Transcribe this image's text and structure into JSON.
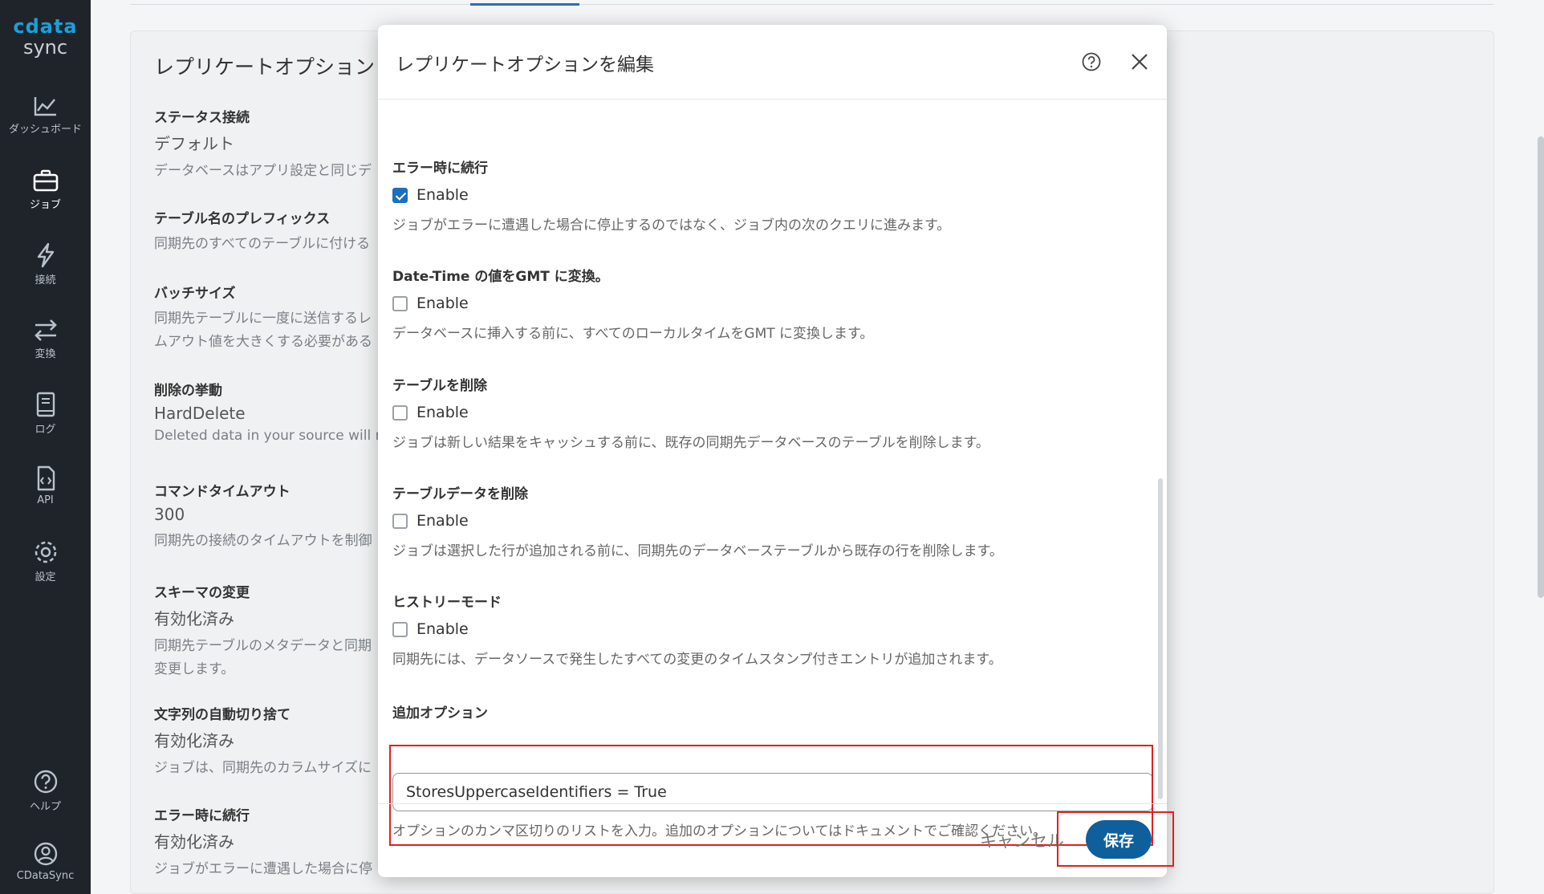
{
  "sidebar": {
    "logo_top": "cdata",
    "logo_bottom": "sync",
    "items": [
      {
        "label": "ダッシュボード",
        "icon": "chart-line-icon"
      },
      {
        "label": "ジョブ",
        "icon": "briefcase-icon"
      },
      {
        "label": "接続",
        "icon": "lightning-icon"
      },
      {
        "label": "変換",
        "icon": "arrows-swap-icon"
      },
      {
        "label": "ログ",
        "icon": "log-book-icon"
      },
      {
        "label": "API",
        "icon": "api-file-icon"
      },
      {
        "label": "設定",
        "icon": "gear-icon"
      },
      {
        "label": "ヘルプ",
        "icon": "help-circle-icon"
      },
      {
        "label": "CDataSync",
        "icon": "user-icon"
      }
    ]
  },
  "background": {
    "title": "レプリケートオプション",
    "items": [
      {
        "label": "ステータス接続",
        "value": "デフォルト",
        "desc": "データベースはアプリ設定と同じデ"
      },
      {
        "label": "テーブル名のプレフィックス",
        "desc": "同期先のすべてのテーブルに付ける"
      },
      {
        "label": "バッチサイズ",
        "desc": "同期先テーブルに一度に送信するレ",
        "desc2": "ムアウト値を大きくする必要がある"
      },
      {
        "label": "削除の挙動",
        "value": "HardDelete",
        "desc": "Deleted data in your source will remo"
      },
      {
        "label": "コマンドタイムアウト",
        "value": "300",
        "desc": "同期先の接続のタイムアウトを制御"
      },
      {
        "label": "スキーマの変更",
        "value": "有効化済み",
        "desc": "同期先テーブルのメタデータと同期",
        "desc2": "変更します。"
      },
      {
        "label": "文字列の自動切り捨て",
        "value": "有効化済み",
        "desc": "ジョブは、同期先のカラムサイズに"
      },
      {
        "label": "エラー時に続行",
        "value": "有効化済み",
        "desc": "ジョブがエラーに遭遇した場合に停"
      }
    ]
  },
  "modal": {
    "title": "レプリケートオプションを編集",
    "options": [
      {
        "label": "エラー時に続行",
        "checkbox_label": "Enable",
        "checked": true,
        "desc": "ジョブがエラーに遭遇した場合に停止するのではなく、ジョブ内の次のクエリに進みます。"
      },
      {
        "label": "Date-Time の値をGMT に変換。",
        "checkbox_label": "Enable",
        "checked": false,
        "desc": "データベースに挿入する前に、すべてのローカルタイムをGMT に変換します。"
      },
      {
        "label": "テーブルを削除",
        "checkbox_label": "Enable",
        "checked": false,
        "desc": "ジョブは新しい結果をキャッシュする前に、既存の同期先データベースのテーブルを削除します。"
      },
      {
        "label": "テーブルデータを削除",
        "checkbox_label": "Enable",
        "checked": false,
        "desc": "ジョブは選択した行が追加される前に、同期先のデータベーステーブルから既存の行を削除します。"
      },
      {
        "label": "ヒストリーモード",
        "checkbox_label": "Enable",
        "checked": false,
        "desc": "同期先には、データソースで発生したすべての変更のタイムスタンプ付きエントリが追加されます。"
      }
    ],
    "extra": {
      "label": "追加オプション",
      "value": "StoresUppercaseIdentifiers = True",
      "desc": "オプションのカンマ区切りのリストを入力。追加のオプションについてはドキュメントでご確認ください。"
    },
    "cancel_label": "キャンセル",
    "save_label": "保存"
  },
  "colors": {
    "sidebar_bg": "#1f242b",
    "accent": "#1b6fc2",
    "save_button": "#0e5f9c",
    "highlight": "#e02020"
  }
}
